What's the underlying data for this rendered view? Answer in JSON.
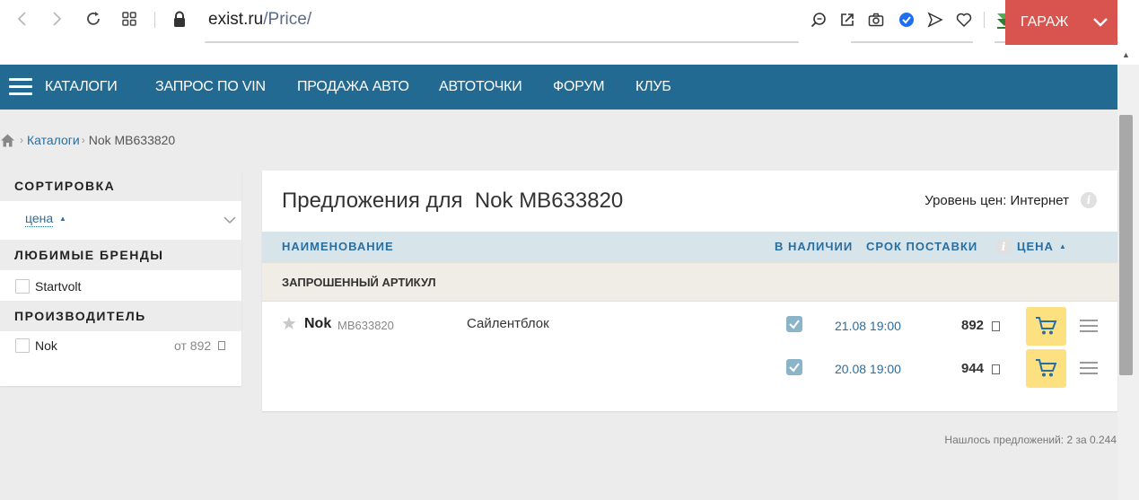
{
  "browser": {
    "url_host": "exist.ru",
    "url_path": "/Price/",
    "icons": [
      "back-icon",
      "forward-icon",
      "reload-icon",
      "tabs-grid-icon",
      "lock-icon",
      "search-page-icon",
      "share-icon",
      "camera-icon",
      "shield-check-icon",
      "send-icon",
      "heart-icon",
      "download-arrow-icon",
      "cube-icon",
      "downloads-icon",
      "settings-sliders-icon"
    ]
  },
  "nav": {
    "catalogs": "КАТАЛОГИ",
    "vin": "ЗАПРОС ПО VIN",
    "sale": "ПРОДАЖА АВТО",
    "points": "АВТОТОЧКИ",
    "forum": "ФОРУМ",
    "club": "КЛУБ",
    "garage": "ГАРАЖ",
    "bg_color": "#236a93",
    "garage_color": "#d9534f"
  },
  "breadcrumb": {
    "catalogs": "Каталоги",
    "current": "Nok MB633820"
  },
  "sidebar": {
    "sort_title": "СОРТИРОВКА",
    "sort_value": "цена",
    "brands_title": "ЛЮБИМЫЕ БРЕНДЫ",
    "brands": [
      {
        "label": "Startvolt",
        "checked": false
      }
    ],
    "maker_title": "ПРОИЗВОДИТЕЛЬ",
    "makers": [
      {
        "label": "Nok",
        "price": "от 892",
        "checked": false
      }
    ]
  },
  "offers": {
    "title": "Предложения для  Nok MB633820",
    "price_level": "Уровень цен: Интернет",
    "columns": {
      "name": "НАИМЕНОВАНИЕ",
      "availability": "В НАЛИЧИИ",
      "delivery": "СРОК ПОСТАВКИ",
      "price": "ЦЕНА"
    },
    "section": "ЗАПРОШЕННЫЙ АРТИКУЛ",
    "product": {
      "brand": "Nok",
      "article": "MB633820",
      "description": "Сайлентблок"
    },
    "rows": [
      {
        "delivery": "21.08 19:00",
        "price": "892",
        "in_stock": true
      },
      {
        "delivery": "20.08 19:00",
        "price": "944",
        "in_stock": true
      }
    ],
    "cart_color": "#fde07f"
  },
  "footer": {
    "found": "Нашлось предложений: 2 за 0.244"
  }
}
